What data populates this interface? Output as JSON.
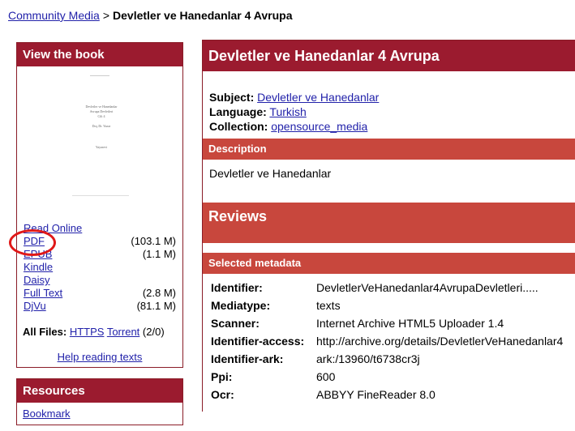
{
  "breadcrumb": {
    "link": "Community Media",
    "separator": ">",
    "current": "Devletler ve Hanedanlar 4 Avrupa"
  },
  "view_book": {
    "title": "View the book",
    "thumbnail_lines": [
      "Devletler ve Hanedanlar",
      "Avrupa Devletleri",
      "Cilt 4",
      "Doç.Dr. Yazar",
      "Yayınevi"
    ],
    "downloads": [
      {
        "label": "Read Online",
        "size": ""
      },
      {
        "label": "PDF",
        "size": "(103.1 M)"
      },
      {
        "label": "EPUB",
        "size": "(1.1 M)"
      },
      {
        "label": "Kindle",
        "size": ""
      },
      {
        "label": "Daisy",
        "size": ""
      },
      {
        "label": "Full Text",
        "size": "(2.8 M)"
      },
      {
        "label": "DjVu",
        "size": "(81.1 M)"
      }
    ],
    "all_files_label": "All Files:",
    "https_link": "HTTPS",
    "torrent_link": "Torrent",
    "torrent_count": "(2/0)",
    "help_link": "Help reading texts"
  },
  "resources": {
    "title": "Resources",
    "bookmark": "Bookmark"
  },
  "main": {
    "title": "Devletler ve Hanedanlar 4 Avrupa",
    "subject_label": "Subject:",
    "subject_value": "Devletler ve Hanedanlar",
    "language_label": "Language:",
    "language_value": "Turkish",
    "collection_label": "Collection:",
    "collection_value": "opensource_media",
    "description_header": "Description",
    "description_text": "Devletler ve Hanedanlar",
    "reviews_header": "Reviews",
    "metadata_header": "Selected metadata",
    "metadata": [
      {
        "key": "Identifier:",
        "value": "DevletlerVeHanedanlar4AvrupaDevletleri....."
      },
      {
        "key": "Mediatype:",
        "value": "texts"
      },
      {
        "key": "Scanner:",
        "value": "Internet Archive HTML5 Uploader 1.4"
      },
      {
        "key": "Identifier-access:",
        "value": "http://archive.org/details/DevletlerVeHanedanlar4"
      },
      {
        "key": "Identifier-ark:",
        "value": "ark:/13960/t6738cr3j"
      },
      {
        "key": "Ppi:",
        "value": "600"
      },
      {
        "key": "Ocr:",
        "value": "ABBYY FineReader 8.0"
      }
    ]
  },
  "colors": {
    "header_dark": "#9b1b2f",
    "section_red": "#c8473d",
    "link": "#2222aa",
    "annotation_ring": "#e01818"
  }
}
